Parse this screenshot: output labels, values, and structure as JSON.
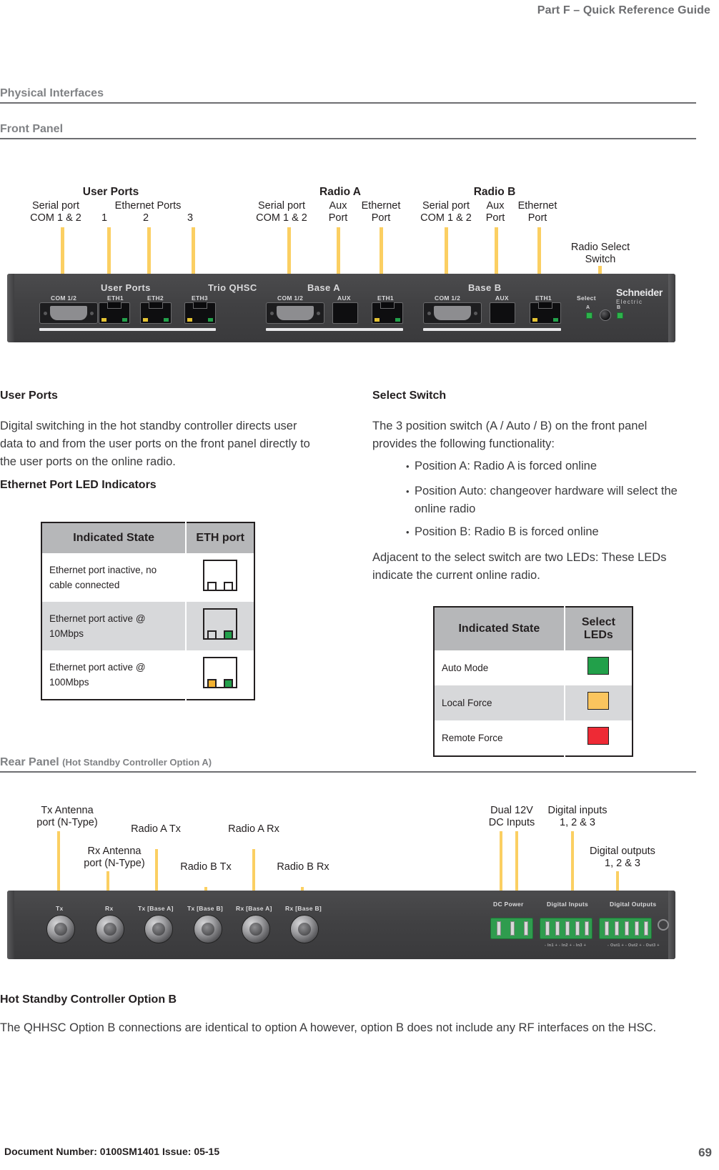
{
  "running_head": "Part F – Quick Reference Guide",
  "sections": {
    "physical_interfaces": "Physical Interfaces",
    "front_panel": "Front Panel",
    "rear_panel_title": "Rear Panel",
    "rear_panel_sub": "(Hot Standby Controller Option A)"
  },
  "front_panel_callouts": {
    "user_ports_group": "User Ports",
    "serial_port_user": "Serial port\nCOM 1 & 2",
    "ethernet_ports": "Ethernet Ports",
    "eth_1": "1",
    "eth_2": "2",
    "eth_3": "3",
    "radio_a_group": "Radio A",
    "radio_a_serial": "Serial port\nCOM 1 & 2",
    "radio_a_aux": "Aux\nPort",
    "radio_a_eth": "Ethernet\nPort",
    "radio_b_group": "Radio B",
    "radio_b_serial": "Serial port\nCOM 1 & 2",
    "radio_b_aux": "Aux\nPort",
    "radio_b_eth": "Ethernet\nPort",
    "radio_select_switch": "Radio Select\nSwitch"
  },
  "front_panel_silkscreen": {
    "user_ports": "User Ports",
    "model": "Trio QHSC",
    "base_a": "Base A",
    "base_b": "Base B",
    "com_1": "COM 1/2",
    "eth1": "ETH1",
    "eth2": "ETH2",
    "eth3": "ETH3",
    "com_a": "COM 1/2",
    "aux_a": "AUX",
    "eth_a": "ETH1",
    "com_b": "COM 1/2",
    "aux_b": "AUX",
    "eth_b": "ETH1",
    "select": "Select",
    "led_a": "A",
    "led_b": "B",
    "brand": "Schneider",
    "brand_sub": "Electric"
  },
  "user_ports": {
    "heading": "User Ports",
    "body": "Digital switching in the hot standby controller directs user data to and from the user ports on the front panel directly to the user ports on the online radio."
  },
  "eth_led": {
    "heading": "Ethernet Port LED Indicators",
    "columns": [
      "Indicated State",
      "ETH port"
    ],
    "rows": [
      {
        "state": "Ethernet port inactive, no cable connected",
        "left_led": "off",
        "right_led": "off"
      },
      {
        "state": "Ethernet port active @ 10Mbps",
        "left_led": "off",
        "right_led": "green"
      },
      {
        "state": "Ethernet port active   @ 100Mbps",
        "left_led": "amber",
        "right_led": "green"
      }
    ]
  },
  "select_switch": {
    "heading": "Select Switch",
    "intro": "The 3 position switch (A / Auto / B) on the front panel provides the following functionality:",
    "bullets": [
      "Position A: Radio A is forced online",
      "Position Auto: changeover hardware will select the online radio",
      "Position B: Radio B is forced online"
    ],
    "closing": "Adjacent to the select switch are two LEDs: These LEDs indicate the current online radio."
  },
  "select_leds": {
    "columns": [
      "Indicated State",
      "Select LEDs"
    ],
    "rows": [
      {
        "state": "Auto Mode",
        "color": "#22a04a"
      },
      {
        "state": "Local Force",
        "color": "#fbc55e"
      },
      {
        "state": "Remote Force",
        "color": "#ee2a35"
      }
    ]
  },
  "rear_panel_callouts": {
    "tx_antenna": "Tx Antenna\nport (N-Type)",
    "rx_antenna": "Rx Antenna\nport (N-Type)",
    "radio_a_tx": "Radio A Tx",
    "radio_a_rx": "Radio A Rx",
    "radio_b_tx": "Radio B Tx",
    "radio_b_rx": "Radio B Rx",
    "dual_dc": "Dual 12V\nDC Inputs",
    "digital_inputs": "Digital inputs\n1, 2 & 3",
    "digital_outputs": "Digital outputs\n1, 2 & 3"
  },
  "rear_panel_silkscreen": {
    "tx": "Tx",
    "rx": "Rx",
    "tx_base_a": "Tx [Base A]",
    "tx_base_b": "Tx [Base B]",
    "rx_base_a": "Rx [Base A]",
    "rx_base_b": "Rx [Base B]",
    "dc_power": "DC Power",
    "digital_inputs": "Digital Inputs",
    "digital_outputs": "Digital Outputs",
    "din_legend": "- In1 +  - In2 +  - In3 +",
    "dout_legend": "- Out1 +  - Out2 +  - Out3 +"
  },
  "option_b": {
    "heading": "Hot Standby Controller Option B",
    "body": "The QHHSC Option B connections are identical to option A however, option B does not include any RF interfaces on the HSC."
  },
  "footer": {
    "doc": "Document Number: 0100SM1401    Issue: 05-15",
    "page": "69"
  },
  "colors": {
    "leader": "#fbcf62",
    "heading_gray": "#808285",
    "table_header": "#b6b7b9",
    "table_alt": "#d7d8da",
    "led_green": "#22a04a",
    "led_amber": "#f2b232",
    "led_red": "#ee2a35"
  }
}
